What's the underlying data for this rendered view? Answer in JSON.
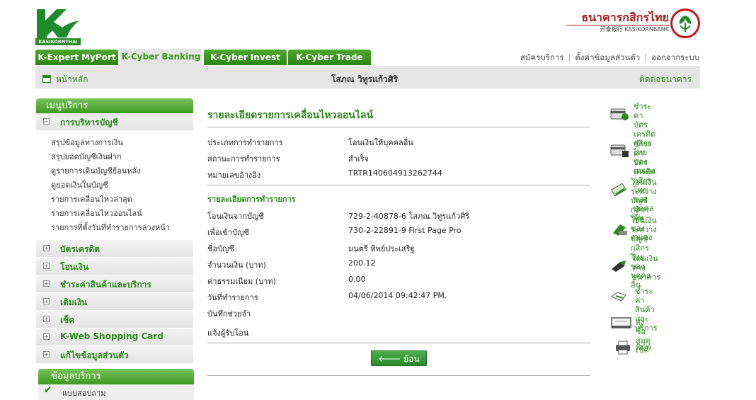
{
  "header": {
    "logo_text": "KASIKORNTHAI",
    "bank_name_th": "ธนาคารกสิกรไทย",
    "bank_name_en": "开泰银行 KASIKORNBANK"
  },
  "tabs": [
    {
      "label": "K-Expert MyPort"
    },
    {
      "label": "K-Cyber Banking"
    },
    {
      "label": "K-Cyber Invest"
    },
    {
      "label": "K-Cyber Trade"
    }
  ],
  "top_links": {
    "register": "สมัครบริการ",
    "settings": "ตั้งค่าข้อมูลส่วนตัว",
    "logout": "ออกจากระบบ"
  },
  "navbar": {
    "home": "หน้าหลัก",
    "user": "โสภณ วิทูรแก้วศิริ",
    "contact": "ติดต่อธนาคาร"
  },
  "sidebar": {
    "title": "เมนูบริการ",
    "account_section": "การบริหารบัญชี",
    "account_links": [
      "สรุปข้อมูลทางการเงิน",
      "สรุปยอดบัญชีเงินฝาก",
      "ดูรายการเดินบัญชีย้อนหลัง",
      "ดูยอดเงินในบัญชี",
      "รายการเคลื่อนไหวล่าสุด",
      "รายการเคลื่อนไหวออนไลน์",
      "รายการที่ตั้งวันที่ทำรายการล่วงหน้า"
    ],
    "sections": [
      "บัตรเครดิต",
      "โอนเงิน",
      "ชำระค่าสินค้าและบริการ",
      "เติมเงิน",
      "เช็ค",
      "K-Web Shopping Card",
      "แก้ไขข้อมูลส่วนตัว"
    ],
    "info_title": "ข้อมูลบริการ",
    "info_item": "แบบสอบถาม"
  },
  "main": {
    "title": "รายละเอียดรายการเคลื่อนไหวออนไลน์",
    "summary": [
      {
        "label": "ประเภทการทำรายการ",
        "value": "โอนเงินให้บุคคลอื่น"
      },
      {
        "label": "สถานะการทำรายการ",
        "value": "สำเร็จ"
      },
      {
        "label": "หมายเลขอ้างอิง",
        "value": "TRTR140604913262744"
      }
    ],
    "detail_title": "รายละเอียดการทำรายการ",
    "details": [
      {
        "label": "โอนเงินจากบัญชี",
        "value": "729-2-40878-6 โสภณ วิทูรแก้วศิริ"
      },
      {
        "label": "เพื่อเข้าบัญชี",
        "value": "730-2-22891-9 First Page Pro"
      },
      {
        "label": "ชื่อบัญชี",
        "value": "มนตรี ทิพย์ประเสริฐ"
      },
      {
        "label": "จำนวนเงิน (บาท)",
        "value": "200.12"
      },
      {
        "label": "ค่าธรรมเนียม (บาท)",
        "value": "0.00"
      },
      {
        "label": "วันที่ทำรายการ",
        "value": "04/06/2014 09:42:47 PM."
      },
      {
        "label": "บันทึกช่วยจำ",
        "value": ""
      },
      {
        "label": "แจ้งผู้รับโอน",
        "value": ""
      }
    ],
    "back_button": "ย้อนกลับ"
  },
  "right_menu": [
    {
      "icon": "credit-card-pay-own-icon",
      "lines": [
        "ชำระค่าบัตร",
        "เครดิตกสิกรไทย",
        "ของตนเอง"
      ]
    },
    {
      "icon": "credit-card-pay-other-icon",
      "lines": [
        "ชำระค่าบัตร",
        "เครดิตกสิกรไทย",
        "ของบุคคลอื่น"
      ]
    },
    {
      "icon": "transfer-own-icon",
      "lines": [
        "โอนเงินระหว่าง",
        "บัญชีกสิกรไทย",
        "ของตนเอง"
      ]
    },
    {
      "icon": "transfer-other-icon",
      "lines": [
        "โอนเงินระหว่าง",
        "บัญชีกสิกรไทย",
        "ของบุคคลอื่น"
      ]
    },
    {
      "icon": "transfer-interbank-icon",
      "lines": [
        "โอนเงิน",
        "ต่างธนาคาร"
      ]
    },
    {
      "icon": "bill-payment-icon",
      "lines": [
        "ชำระค่าสินค้า",
        "และบริการ"
      ]
    },
    {
      "icon": "cheque-book-icon",
      "lines": [
        "สั่งซื้อสมุดเช็ค"
      ]
    },
    {
      "icon": "print-icon",
      "lines": [
        "พิมพ์"
      ]
    }
  ]
}
